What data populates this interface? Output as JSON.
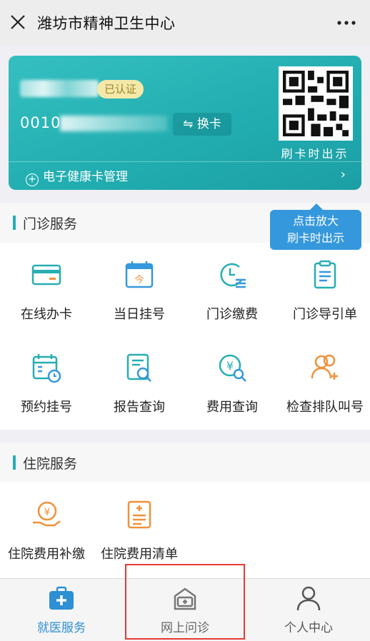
{
  "window": {
    "title": "潍坊市精神卫生中心"
  },
  "card": {
    "status_badge": "已认证",
    "card_number_prefix": "0010",
    "switch_label": "换卡",
    "qr_caption": "刷卡时出示",
    "manage_label": "电子健康卡管理"
  },
  "tooltip": {
    "line1": "点击放大",
    "line2": "刷卡时出示"
  },
  "outpatient": {
    "title": "门诊服务",
    "items": [
      {
        "label": "在线办卡",
        "icon": "card-icon"
      },
      {
        "label": "当日挂号",
        "icon": "calendar-today-icon"
      },
      {
        "label": "门诊缴费",
        "icon": "payment-clock-icon"
      },
      {
        "label": "门诊导引单",
        "icon": "clipboard-icon"
      },
      {
        "label": "预约挂号",
        "icon": "calendar-clock-icon"
      },
      {
        "label": "报告查询",
        "icon": "report-search-icon"
      },
      {
        "label": "费用查询",
        "icon": "yen-search-icon"
      },
      {
        "label": "检查排队叫号",
        "icon": "queue-people-icon"
      }
    ]
  },
  "inpatient": {
    "title": "住院服务",
    "items": [
      {
        "label": "住院费用补缴",
        "icon": "yen-hand-icon"
      },
      {
        "label": "住院费用清单",
        "icon": "bill-list-icon"
      }
    ]
  },
  "tabbar": {
    "items": [
      {
        "label": "就医服务",
        "icon": "medical-kit-icon",
        "active": true
      },
      {
        "label": "网上问诊",
        "icon": "online-consult-icon",
        "active": false
      },
      {
        "label": "个人中心",
        "icon": "person-icon",
        "active": false
      }
    ]
  },
  "colors": {
    "teal": "#26aeb2",
    "tooltip_blue": "#3598dc",
    "icon_orange": "#f0913a",
    "tab_active": "#2d8fd4",
    "highlight_red": "#e53935"
  }
}
